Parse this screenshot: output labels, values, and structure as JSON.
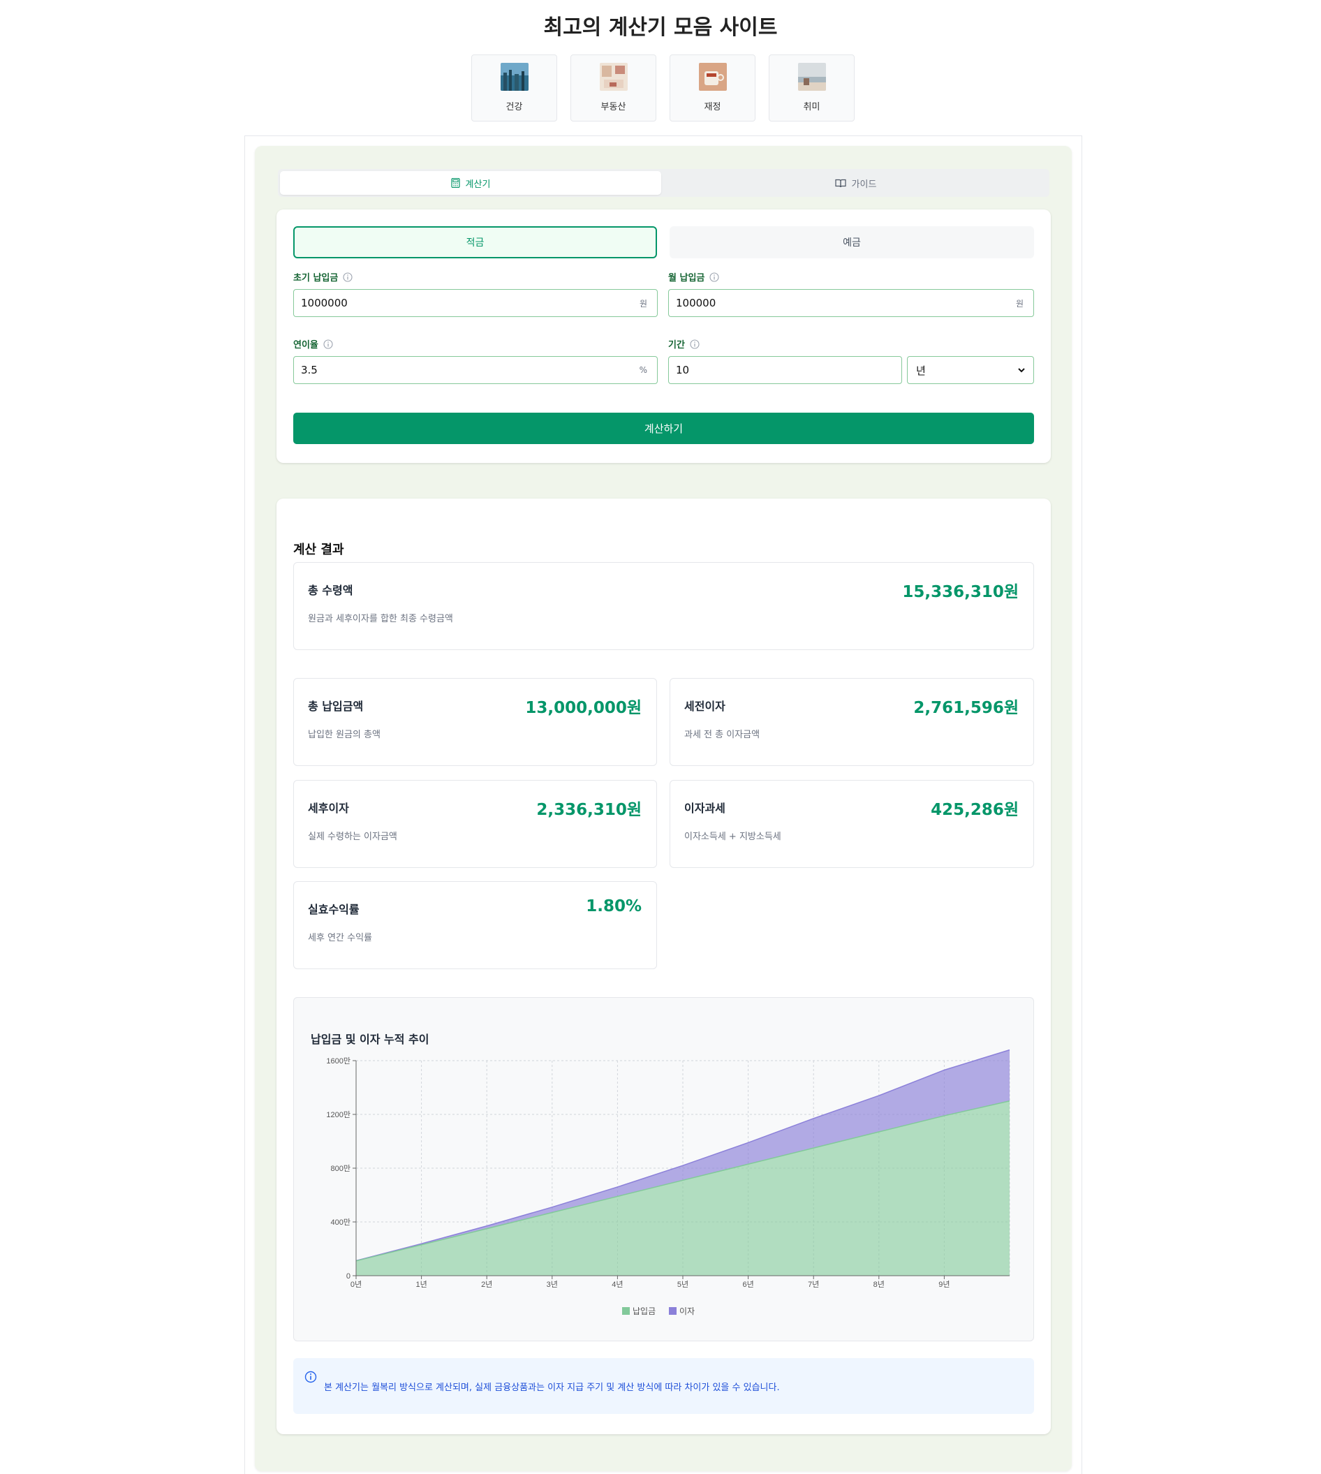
{
  "site": {
    "title": "최고의 계산기 모음 사이트"
  },
  "categories": [
    {
      "label": "건강",
      "icon": "city-skyline-thumbnail"
    },
    {
      "label": "부동산",
      "icon": "interior-thumbnail"
    },
    {
      "label": "재정",
      "icon": "coffee-cup-thumbnail"
    },
    {
      "label": "취미",
      "icon": "beach-thumbnail"
    }
  ],
  "tabs": {
    "calculator": "계산기",
    "guide": "가이드",
    "active": "calculator"
  },
  "mode": {
    "savings": "적금",
    "deposit": "예금",
    "active": "savings"
  },
  "form": {
    "initial_deposit": {
      "label": "초기 납입금",
      "value": "1000000",
      "unit": "원"
    },
    "monthly_deposit": {
      "label": "월 납입금",
      "value": "100000",
      "unit": "원"
    },
    "annual_rate": {
      "label": "연이율",
      "value": "3.5",
      "unit": "%"
    },
    "period": {
      "label": "기간",
      "value": "10",
      "unit_selected": "년"
    },
    "submit_label": "계산하기"
  },
  "results": {
    "title": "계산 결과",
    "total_receipt": {
      "label": "총 수령액",
      "value": "15,336,310원",
      "desc": "원금과 세후이자를 합한 최종 수령금액"
    },
    "total_paid": {
      "label": "총 납입금액",
      "value": "13,000,000원",
      "desc": "납입한 원금의 총액"
    },
    "pretax_interest": {
      "label": "세전이자",
      "value": "2,761,596원",
      "desc": "과세 전 총 이자금액"
    },
    "aftertax_interest": {
      "label": "세후이자",
      "value": "2,336,310원",
      "desc": "실제 수령하는 이자금액"
    },
    "interest_tax": {
      "label": "이자과세",
      "value": "425,286원",
      "desc": "이자소득세 + 지방소득세"
    },
    "effective_yield": {
      "label": "실효수익률",
      "value": "1.80%",
      "desc": "세후 연간 수익률"
    }
  },
  "chart_data": {
    "type": "area",
    "stacked": true,
    "title": "납입금 및 이자 누적 추이",
    "x": [
      "0년",
      "1년",
      "2년",
      "3년",
      "4년",
      "5년",
      "6년",
      "7년",
      "8년",
      "9년"
    ],
    "y_ticks": [
      "0",
      "400만",
      "800만",
      "1200만",
      "1600만"
    ],
    "ylim": [
      0,
      1600
    ],
    "y_unit": "만",
    "grid": true,
    "legend_position": "bottom",
    "series": [
      {
        "name": "납입금",
        "color": "#82c99a",
        "values": [
          110,
          230,
          350,
          470,
          590,
          710,
          830,
          950,
          1070,
          1190,
          1300
        ]
      },
      {
        "name": "이자",
        "color": "#8b80d9",
        "values": [
          2,
          8,
          20,
          40,
          70,
          110,
          160,
          220,
          270,
          340,
          380
        ]
      }
    ],
    "x_values_months": [
      0,
      12,
      24,
      36,
      48,
      60,
      72,
      84,
      96,
      108,
      120
    ]
  },
  "notice": {
    "text": "본 계산기는 월복리 방식으로 계산되며, 실제 금융상품과는 이자 지급 주기 및 계산 방식에 따라 차이가 있을 수 있습니다."
  },
  "colors": {
    "accent": "#059669",
    "panel_bg": "#f0f5eb",
    "notice_bg": "#eff6ff",
    "notice_text": "#1d4ed8"
  }
}
